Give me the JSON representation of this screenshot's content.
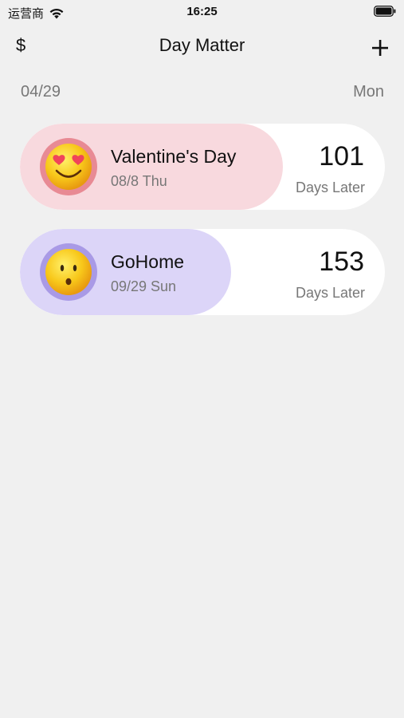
{
  "status_bar": {
    "carrier": "运营商",
    "time": "16:25"
  },
  "nav": {
    "left_label": "$",
    "title": "Day Matter",
    "right_icon": "plus-icon"
  },
  "date_row": {
    "date": "04/29",
    "weekday": "Mon"
  },
  "events": [
    {
      "name": "Valentine's Day",
      "date": "08/8 Thu",
      "days": "101",
      "days_label": "Days Later",
      "emoji": "heart-eyes-emoji-icon",
      "fill_color": "#f8d9de",
      "ring_color": "#e88a94"
    },
    {
      "name": "GoHome",
      "date": "09/29 Sun",
      "days": "153",
      "days_label": "Days Later",
      "emoji": "surprised-emoji-icon",
      "fill_color": "#dcd5f8",
      "ring_color": "#a99ae6"
    }
  ]
}
